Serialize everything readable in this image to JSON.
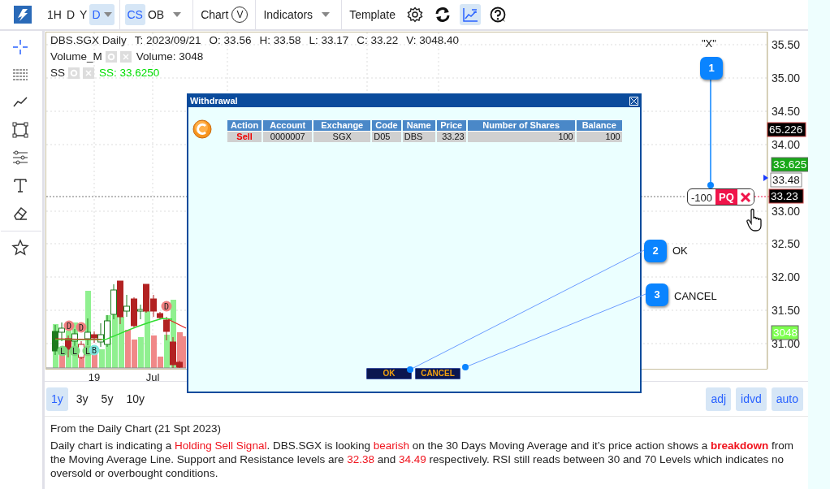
{
  "toolbar": {
    "intervals": [
      {
        "label": "1H",
        "kind": "button",
        "selected": false
      },
      {
        "label": "D",
        "kind": "button",
        "selected": false
      },
      {
        "label": "Y",
        "kind": "button",
        "selected": false
      },
      {
        "label": "D",
        "kind": "dropdown",
        "selected": true
      }
    ],
    "chart_types": [
      {
        "label": "CS",
        "selected": true
      },
      {
        "label": "OB",
        "selected": false
      }
    ],
    "chart_menu": {
      "label": "Chart",
      "badge": "V"
    },
    "indicators_menu": {
      "label": "Indicators"
    },
    "template_menu": {
      "label": "Template"
    },
    "tools": [
      {
        "kind": "settings",
        "selected": false
      },
      {
        "kind": "refresh",
        "selected": false
      },
      {
        "kind": "chart",
        "selected": true
      },
      {
        "kind": "help",
        "selected": false
      }
    ]
  },
  "drawing_tools": [
    {
      "kind": "crosshair",
      "selected": true
    },
    {
      "kind": "lines",
      "selected": false
    },
    {
      "kind": "trend",
      "selected": false
    },
    {
      "kind": "rectangle",
      "selected": false
    },
    {
      "kind": "levels",
      "selected": false
    },
    {
      "kind": "text",
      "selected": false
    },
    {
      "kind": "eraser",
      "selected": false
    },
    {
      "kind": "favorite",
      "selected": false
    }
  ],
  "chart": {
    "legend": {
      "symbol": "DBS.SGX Daily",
      "values": [
        "T: 2023/09/21",
        "O: 33.56",
        "H: 33.58",
        "L: 33.17",
        "C: 33.22",
        "V: 3048.40"
      ],
      "indicators": [
        {
          "name": "Volume_M",
          "reading": "Volume: 3048",
          "color": "#222222"
        },
        {
          "name": "SS",
          "reading": "SS: 33.6250",
          "color": "#00dd00"
        }
      ]
    },
    "price_ticks": [
      "35.50",
      "35.00",
      "34.50",
      "34.00",
      "33.00",
      "32.50",
      "32.00",
      "31.50",
      "31.00"
    ],
    "price_tags": [
      {
        "text": "65.226",
        "kind": "dark"
      },
      {
        "text": "33.625",
        "kind": "green"
      },
      {
        "text": "33.48",
        "kind": "outline"
      },
      {
        "text": "33.23",
        "kind": "dark"
      },
      {
        "text": "3048",
        "kind": "green"
      }
    ],
    "time_labels": [
      "19",
      "Jul"
    ],
    "markers": [
      {
        "label": "D",
        "color": "#f08080"
      },
      {
        "label": "D",
        "color": "#f08080"
      },
      {
        "label": "D",
        "color": "#f08080"
      },
      {
        "label": "L",
        "color": "#7ed87e"
      },
      {
        "label": "L",
        "color": "#7ed87e"
      },
      {
        "label": "L",
        "color": "#7ed87e"
      },
      {
        "label": "B",
        "color": "#7fe8e0"
      }
    ],
    "order_tag": {
      "quantity": "-100",
      "type": "PQ"
    }
  },
  "dialog": {
    "title": "Withdrawal",
    "columns": [
      "Action",
      "Account",
      "Exchange",
      "Code",
      "Name",
      "Price",
      "Number of Shares",
      "Balance"
    ],
    "rows": [
      {
        "kind": "sell",
        "cells": [
          "Sell",
          "0000007",
          "SGX",
          "D05",
          "DBS",
          "33.23",
          "100",
          "100"
        ]
      }
    ],
    "buttons": [
      "OK",
      "CANCEL"
    ]
  },
  "callouts": [
    {
      "number": "1",
      "label": "\"X\""
    },
    {
      "number": "2",
      "label": "OK"
    },
    {
      "number": "3",
      "label": "CANCEL"
    }
  ],
  "ranges": [
    {
      "label": "1y",
      "selected": true
    },
    {
      "label": "3y",
      "selected": false
    },
    {
      "label": "5y",
      "selected": false
    },
    {
      "label": "10y",
      "selected": false
    }
  ],
  "scale_options": [
    {
      "label": "adj",
      "selected": true
    },
    {
      "label": "idvd",
      "selected": true
    },
    {
      "label": "auto",
      "selected": true
    }
  ],
  "commentary": {
    "heading": "From the Daily Chart (21 Spt 2023)",
    "segments": [
      {
        "text": "Daily chart is indicating a ",
        "kind": "plain"
      },
      {
        "text": "Holding Sell Signal",
        "kind": "highlight"
      },
      {
        "text": ". DBS.SGX is looking ",
        "kind": "plain"
      },
      {
        "text": "bearish",
        "kind": "highlight"
      },
      {
        "text": " on the 30 Days Moving Average and it’s price action shows a ",
        "kind": "plain"
      },
      {
        "text": "breakdown",
        "kind": "strong"
      },
      {
        "text": " from the Moving Average Line. Support and Resistance levels are ",
        "kind": "plain"
      },
      {
        "text": "32.38",
        "kind": "highlight"
      },
      {
        "text": " and ",
        "kind": "plain"
      },
      {
        "text": "34.49",
        "kind": "highlight"
      },
      {
        "text": " respectively. RSI still reads between 30 and 70 Levels which indicates no oversold or overbought conditions.",
        "kind": "plain"
      }
    ]
  }
}
